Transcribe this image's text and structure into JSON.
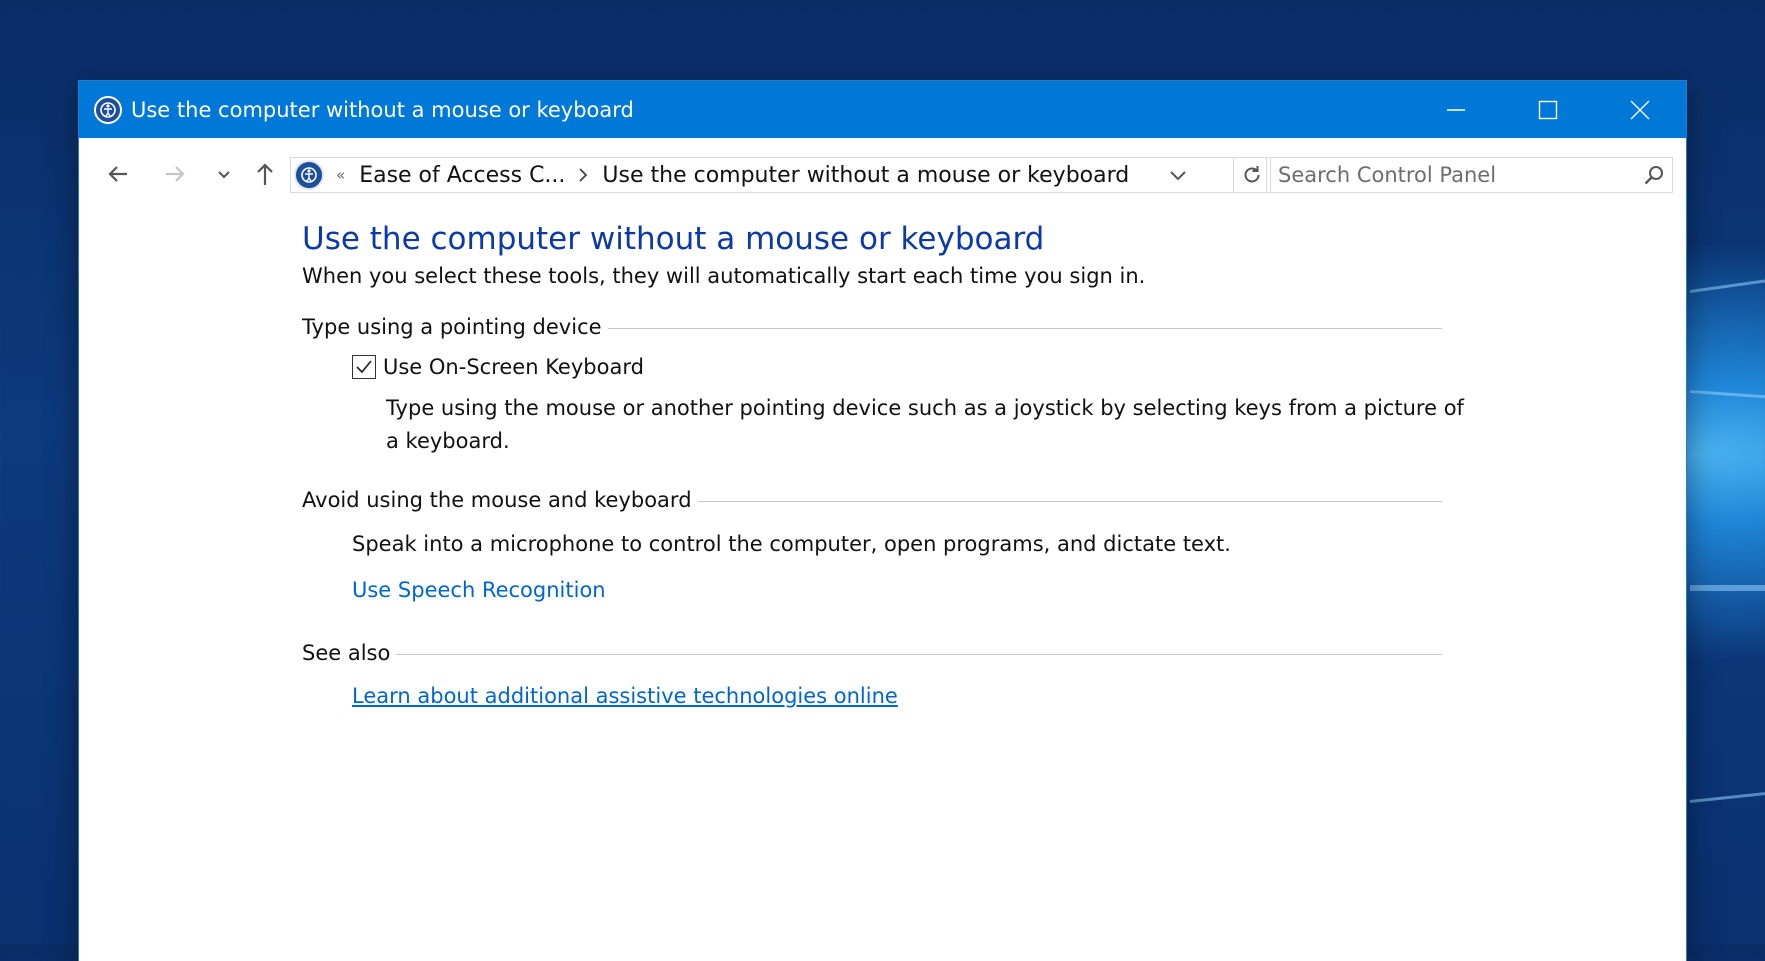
{
  "window": {
    "title": "Use the computer without a mouse or keyboard",
    "app_icon": "ease-of-access-icon",
    "controls": [
      "minimize-icon",
      "maximize-icon",
      "close-icon"
    ]
  },
  "navbar": {
    "breadcrumb": {
      "overflow_marker": "«",
      "items": [
        "Ease of Access C...",
        "Use the computer without a mouse or keyboard"
      ]
    },
    "search": {
      "placeholder": "Search Control Panel"
    }
  },
  "content": {
    "heading": "Use the computer without a mouse or keyboard",
    "intro": "When you select these tools, they will automatically start each time you sign in.",
    "sections": [
      {
        "title": "Type using a pointing device",
        "checkbox": {
          "label": "Use On-Screen Keyboard",
          "checked": true
        },
        "description": "Type using the mouse or another pointing device such as a joystick by selecting keys from a picture of a keyboard."
      },
      {
        "title": "Avoid using the mouse and keyboard",
        "description": "Speak into a microphone to control the computer, open programs, and dictate text.",
        "link": "Use Speech Recognition"
      },
      {
        "title": "See also",
        "link": "Learn about additional assistive technologies online"
      }
    ]
  },
  "colors": {
    "titlebar": "#0078d7",
    "heading": "#0b3aa8",
    "link": "#0066cc"
  }
}
